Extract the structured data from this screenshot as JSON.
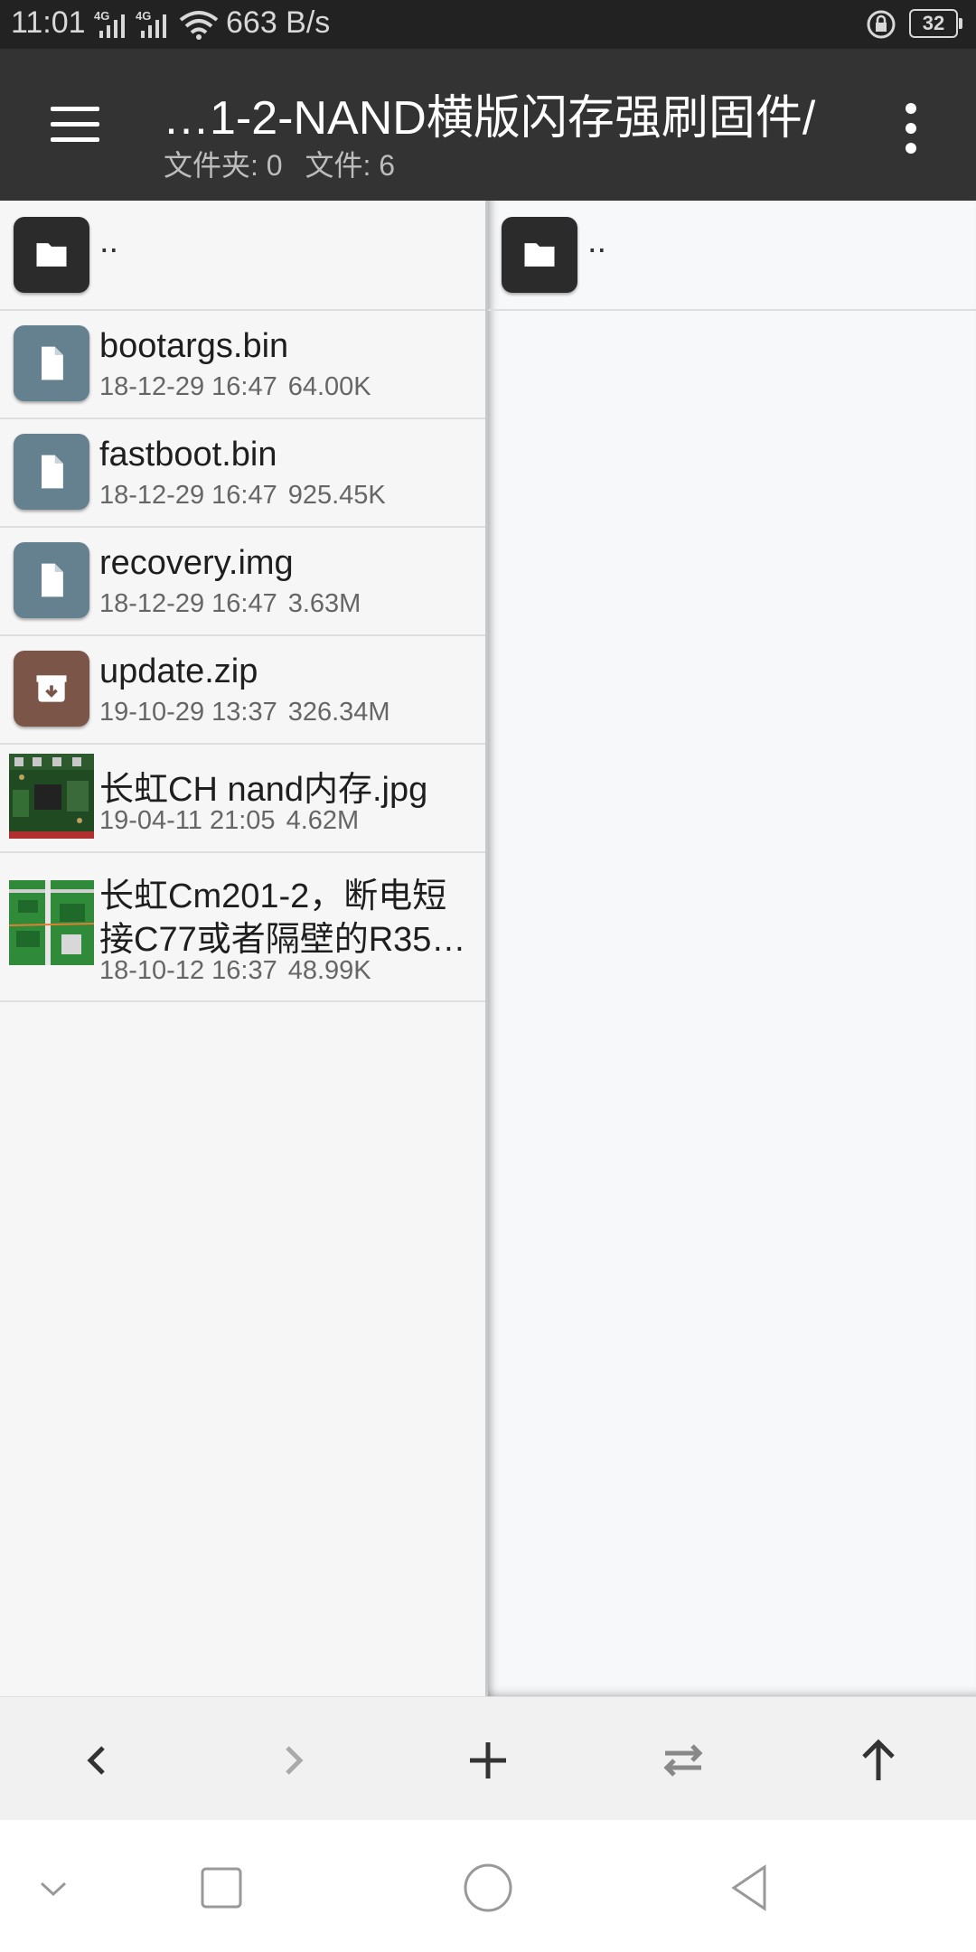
{
  "status_bar": {
    "time": "11:01",
    "signal1": "4G",
    "signal2": "4G",
    "net_speed": "663 B/s",
    "battery": "32"
  },
  "toolbar": {
    "title": "…1-2-NAND横版闪存强刷固件/",
    "folders_count": "文件夹: 0",
    "files_count": "文件: 6"
  },
  "left_pane": {
    "parent_label": "..",
    "files": [
      {
        "name": "bootargs.bin",
        "date": "18-12-29 16:47",
        "size": "64.00K",
        "type": "file-icon"
      },
      {
        "name": "fastboot.bin",
        "date": "18-12-29 16:47",
        "size": "925.45K",
        "type": "file-icon"
      },
      {
        "name": "recovery.img",
        "date": "18-12-29 16:47",
        "size": "3.63M",
        "type": "file-icon"
      },
      {
        "name": "update.zip",
        "date": "19-10-29 13:37",
        "size": "326.34M",
        "type": "archive-icon"
      },
      {
        "name": "长虹CH nand内存.jpg",
        "date": "19-04-11 21:05",
        "size": "4.62M",
        "type": "image-thumbnail"
      },
      {
        "name_line1": "长虹Cm201-2，断电短",
        "name_line2": "接C77或者隔壁的R35…",
        "date": "18-10-12 16:37",
        "size": "48.99K",
        "type": "image-thumbnail"
      }
    ]
  },
  "right_pane": {
    "parent_label": ".."
  },
  "bottom_toolbar": {
    "buttons": [
      "back-icon",
      "forward-icon",
      "add-icon",
      "swap-panes-icon",
      "up-icon"
    ]
  },
  "colors": {
    "toolbar_bg": "#333333",
    "status_bg": "#222222",
    "file_icon": "#65818f",
    "archive_icon": "#7a5548",
    "folder_icon": "#2b2b2b"
  }
}
